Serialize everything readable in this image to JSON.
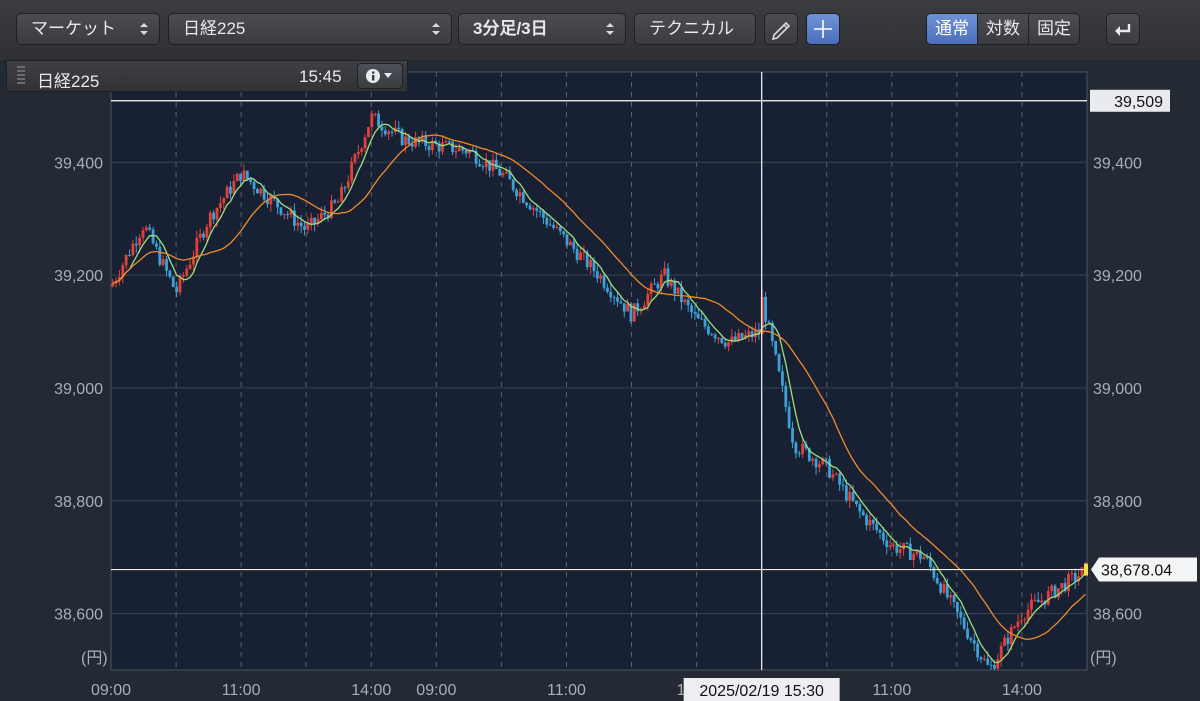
{
  "toolbar": {
    "market_label": "マーケット",
    "symbol_label": "日経225",
    "period_label": "3分足/3日",
    "technical_label": "テクニカル",
    "scale_modes": [
      "通常",
      "対数",
      "固定"
    ],
    "active_scale": "通常"
  },
  "info": {
    "symbol": "日経225",
    "time": "15:45"
  },
  "chart_data": {
    "type": "candlestick",
    "ylim": [
      38500,
      39560
    ],
    "y_ticks": [
      38600,
      38800,
      39000,
      39200,
      39400
    ],
    "y_tick_labels": [
      "38,600",
      "38,800",
      "39,000",
      "39,200",
      "39,400"
    ],
    "y_unit_label": "(円)",
    "x_tick_labels": [
      "09:00",
      "11:00",
      "14:00",
      "09:00",
      "11:00",
      "14:00",
      "11:00",
      "14:00"
    ],
    "high_line": {
      "value": 39509,
      "label": "39,509"
    },
    "current_line": {
      "value": 38678.04,
      "label": "38,678.04"
    },
    "crosshair": {
      "label": "2025/02/19 15:30"
    },
    "series": [
      {
        "name": "price",
        "x": [
          0,
          0.1,
          0.2,
          0.3,
          0.4,
          0.5,
          0.6,
          0.7,
          0.8,
          0.9,
          1.0,
          1.1,
          1.2,
          1.3,
          1.4,
          1.5,
          1.6,
          1.7,
          1.8,
          1.9,
          2.0
        ],
        "y": [
          39180,
          39290,
          39170,
          39300,
          39380,
          39330,
          39280,
          39330,
          39480,
          39440,
          39430,
          39420,
          39380,
          39320,
          39260,
          39200,
          39130,
          39200,
          39120,
          39080,
          39100
        ]
      },
      {
        "name": "price_day3",
        "x": [
          2.0,
          2.1,
          2.2,
          2.3,
          2.4,
          2.5,
          2.6,
          2.7,
          2.8,
          2.9,
          3.0
        ],
        "y": [
          39160,
          38900,
          38860,
          38780,
          38720,
          38700,
          38600,
          38500,
          38600,
          38640,
          38678
        ]
      }
    ]
  },
  "colors": {
    "plot_bg": "#172133",
    "up_candle": "#e0423a",
    "down_candle": "#3fa0d8",
    "ma_short": "#9be07a",
    "ma_long": "#f08a2a",
    "grid": "#3a4454",
    "accent": "#5b7fcb"
  }
}
